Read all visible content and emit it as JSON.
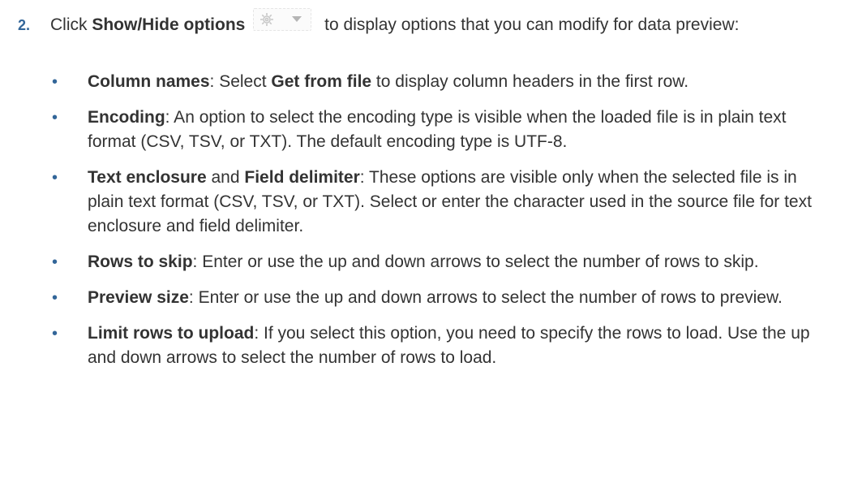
{
  "step": {
    "number": "2.",
    "intro_before": "Click ",
    "button_name": "Show/Hide options",
    "intro_after": " to display options that you can modify for data preview:"
  },
  "icons": {
    "options_button": "gear-dropdown-icon"
  },
  "colors": {
    "accent": "#336699",
    "text": "#333333"
  },
  "bullets": [
    {
      "term": "Column names",
      "text_a": ": Select ",
      "bold_mid": "Get from file",
      "text_b": " to display column headers in the first row."
    },
    {
      "term": "Encoding",
      "text_a": ": An option to select the encoding type is visible when the loaded file is in plain text format (CSV, TSV, or TXT). The default encoding type is UTF-8."
    },
    {
      "term": "Text enclosure",
      "joiner": " and ",
      "term2": "Field delimiter",
      "text_a": ": These options are visible only when the selected file is in plain text format (CSV, TSV, or TXT). Select or enter the character used in the source file for text enclosure and field delimiter."
    },
    {
      "term": "Rows to skip",
      "text_a": ": Enter or use the up and down arrows to select the number of rows to skip."
    },
    {
      "term": "Preview size",
      "text_a": ": Enter or use the up and down arrows to select the number of rows to preview."
    },
    {
      "term": "Limit rows to upload",
      "text_a": ": If you select this option, you need to specify the rows to load. Use the up and down arrows to select the number of rows to load."
    }
  ]
}
